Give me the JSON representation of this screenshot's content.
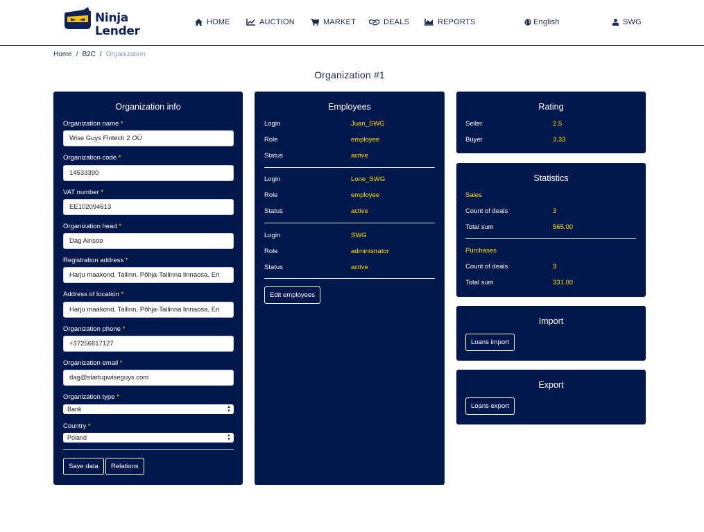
{
  "brand": {
    "line1": "Ninja",
    "line2": "Lender"
  },
  "nav": [
    {
      "label": "HOME",
      "icon": "home-icon"
    },
    {
      "label": "AUCTION",
      "icon": "chart-line-icon"
    },
    {
      "label": "MARKET",
      "icon": "cart-icon"
    },
    {
      "label": "DEALS",
      "icon": "handshake-icon"
    },
    {
      "label": "REPORTS",
      "icon": "area-chart-icon"
    }
  ],
  "language": {
    "label": "English",
    "icon": "globe-icon"
  },
  "user": {
    "label": "SWG",
    "icon": "user-icon"
  },
  "breadcrumb": {
    "items": [
      "Home",
      "B2C"
    ],
    "current": "Organization",
    "separator": "/"
  },
  "page_title": "Organization #1",
  "org_info": {
    "title": "Organization info",
    "required_mark": "*",
    "fields": [
      {
        "label": "Organization name",
        "value": "Wise Guys Fintech 2 OÜ"
      },
      {
        "label": "Organization code",
        "value": "14533390"
      },
      {
        "label": "VAT number",
        "value": "EE102094613"
      },
      {
        "label": "Organization head",
        "value": "Dag Ainsoo"
      },
      {
        "label": "Registration address",
        "value": "Harju maakond, Tallinn, Põhja-Tallinna linnaosa, Eri"
      },
      {
        "label": "Address of location",
        "value": "Harju maakond, Tallinn, Põhja-Tallinna linnaosa, Eri"
      },
      {
        "label": "Organization phone",
        "value": "+37256617127"
      },
      {
        "label": "Organization email",
        "value": "dag@startupwiseguys.com"
      }
    ],
    "selects": [
      {
        "label": "Organization type",
        "value": "Bank"
      },
      {
        "label": "Country",
        "value": "Poland"
      }
    ],
    "save_label": "Save data",
    "relations_label": "Relations"
  },
  "employees": {
    "title": "Employees",
    "keys": {
      "login": "Login",
      "role": "Role",
      "status": "Status"
    },
    "list": [
      {
        "login": "Juan_SWG",
        "role": "employee",
        "status": "active"
      },
      {
        "login": "Lone_SWG",
        "role": "employee",
        "status": "active"
      },
      {
        "login": "SWG",
        "role": "administrator",
        "status": "active"
      }
    ],
    "edit_label": "Edit employees"
  },
  "rating": {
    "title": "Rating",
    "rows": [
      {
        "label": "Seller",
        "value": "2.5"
      },
      {
        "label": "Buyer",
        "value": "3.33"
      }
    ]
  },
  "statistics": {
    "title": "Statistics",
    "sales": {
      "heading": "Sales",
      "rows": [
        {
          "label": "Count of deals",
          "value": "3"
        },
        {
          "label": "Total sum",
          "value": "565.00"
        }
      ]
    },
    "purchases": {
      "heading": "Purchases",
      "rows": [
        {
          "label": "Count of deals",
          "value": "3"
        },
        {
          "label": "Total sum",
          "value": "331.00"
        }
      ]
    }
  },
  "import": {
    "title": "Import",
    "button": "Loans import"
  },
  "export": {
    "title": "Export",
    "button": "Loans export"
  },
  "colors": {
    "card_bg": "#02174b",
    "accent_yellow": "#ffe400",
    "text_dark": "#1c2a4d",
    "logo_yellow": "#f5c400"
  }
}
